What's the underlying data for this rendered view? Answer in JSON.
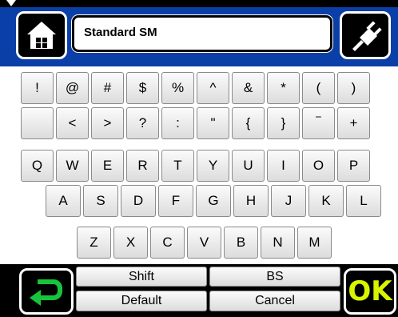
{
  "header": {
    "title": "Standard SM"
  },
  "rows": [
    [
      "!",
      "@",
      "#",
      "$",
      "%",
      "^",
      "&",
      "*",
      "(",
      ")"
    ],
    [
      "",
      "<",
      ">",
      "?",
      ":",
      "\"",
      "{",
      "}",
      "‾",
      "+"
    ],
    [
      "Q",
      "W",
      "E",
      "R",
      "T",
      "Y",
      "U",
      "I",
      "O",
      "P"
    ],
    [
      "A",
      "S",
      "D",
      "F",
      "G",
      "H",
      "J",
      "K",
      "L"
    ],
    [
      "Z",
      "X",
      "C",
      "V",
      "B",
      "N",
      "M"
    ]
  ],
  "controls": {
    "shift": "Shift",
    "bs": "BS",
    "default": "Default",
    "cancel": "Cancel",
    "ok": "OK"
  },
  "colors": {
    "band": "#0b3fa8",
    "ok": "#d8f400",
    "enter_icon": "#16c43c"
  },
  "icons": {
    "home": "home-icon",
    "power": "plug-icon",
    "enter": "enter-arrow-icon"
  }
}
